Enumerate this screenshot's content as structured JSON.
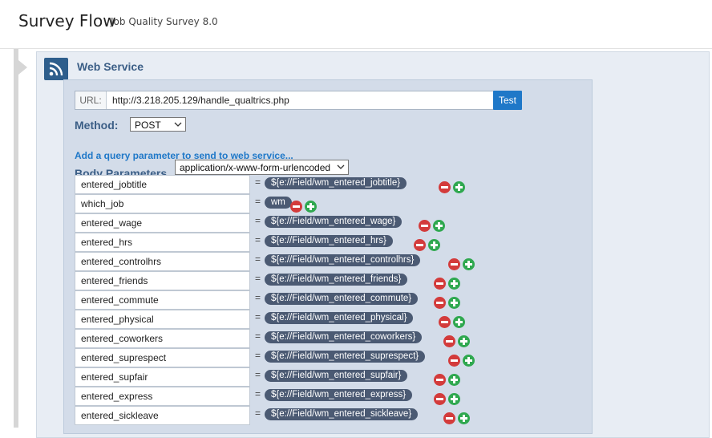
{
  "header": {
    "title": "Survey Flow",
    "subtitle": "Job Quality Survey 8.0"
  },
  "block": {
    "title": "Web Service",
    "icon": "rss-icon",
    "url_label": "URL:",
    "url_value": "http://3.218.205.129/handle_qualtrics.php",
    "test_label": "Test",
    "method_label": "Method:",
    "method_value": "POST",
    "add_param_label": "Add a query parameter to send to web service...",
    "body_label": "Body Parameters",
    "body_encoding": "application/x-www-form-urlencoded",
    "params": [
      {
        "key": "entered_jobtitle",
        "value": "${e://Field/wm_entered_jobtitle}"
      },
      {
        "key": "which_job",
        "value": "wm"
      },
      {
        "key": "entered_wage",
        "value": "${e://Field/wm_entered_wage}"
      },
      {
        "key": "entered_hrs",
        "value": "${e://Field/wm_entered_hrs}"
      },
      {
        "key": "entered_controlhrs",
        "value": "${e://Field/wm_entered_controlhrs}"
      },
      {
        "key": "entered_friends",
        "value": "${e://Field/wm_entered_friends}"
      },
      {
        "key": "entered_commute",
        "value": "${e://Field/wm_entered_commute}"
      },
      {
        "key": "entered_physical",
        "value": "${e://Field/wm_entered_physical}"
      },
      {
        "key": "entered_coworkers",
        "value": "${e://Field/wm_entered_coworkers}"
      },
      {
        "key": "entered_suprespect",
        "value": "${e://Field/wm_entered_suprespect}"
      },
      {
        "key": "entered_supfair",
        "value": "${e://Field/wm_entered_supfair}"
      },
      {
        "key": "entered_express",
        "value": "${e://Field/wm_entered_express}"
      },
      {
        "key": "entered_sickleave",
        "value": "${e://Field/wm_entered_sickleave}"
      }
    ]
  },
  "colors": {
    "accent": "#1f78c8",
    "block_title": "#3b5e86",
    "pill": "#4b5a73",
    "remove": "#d33b3b",
    "add": "#2fa84f"
  }
}
